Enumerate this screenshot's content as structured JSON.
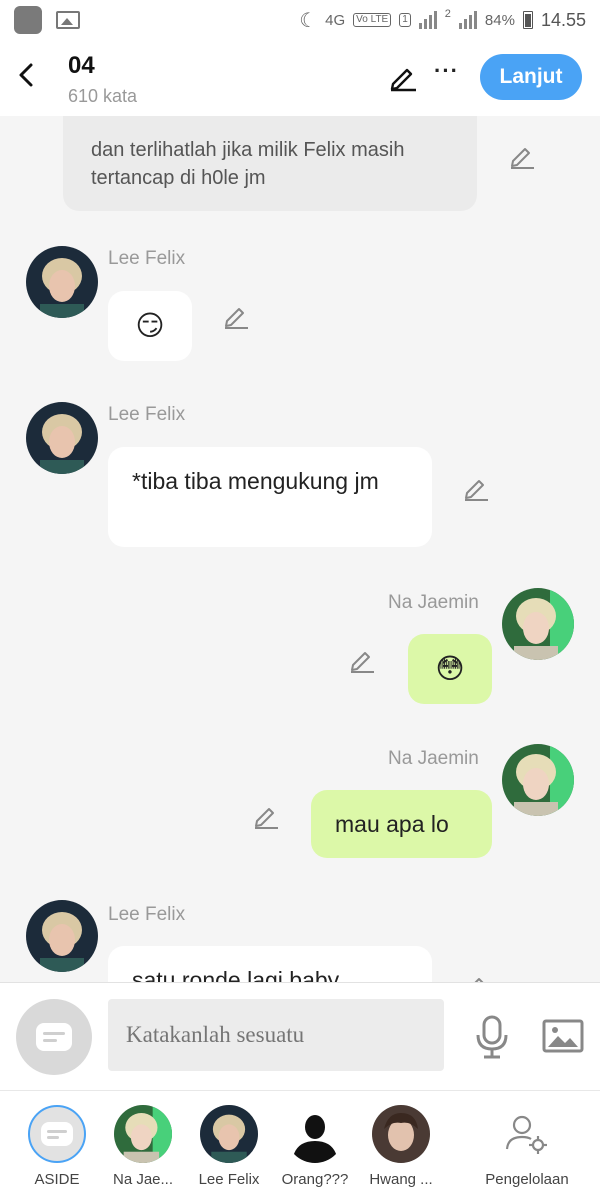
{
  "status_bar": {
    "network": "4G",
    "volte": "Vo LTE",
    "sim1": "1",
    "sim2": "2",
    "battery": "84%",
    "time": "14.55"
  },
  "header": {
    "title": "04",
    "word_count": "610 kata",
    "next_label": "Lanjut"
  },
  "messages": [
    {
      "type": "narration",
      "text": "dan terlihatlah jika milik Felix masih tertancap di h0le jm"
    },
    {
      "type": "left",
      "sender": "Lee Felix",
      "text": "😏"
    },
    {
      "type": "left",
      "sender": "Lee Felix",
      "text": "*tiba tiba mengukung jm"
    },
    {
      "type": "right",
      "sender": "Na Jaemin",
      "text": "😳"
    },
    {
      "type": "right",
      "sender": "Na Jaemin",
      "text": "mau apa lo"
    },
    {
      "type": "left",
      "sender": "Lee Felix",
      "text": "satu ronde lagi baby"
    }
  ],
  "composer": {
    "placeholder": "Katakanlah sesuatu"
  },
  "characters": [
    {
      "label": "ASIDE"
    },
    {
      "label": "Na Jae..."
    },
    {
      "label": "Lee Felix"
    },
    {
      "label": "Orang???"
    },
    {
      "label": "Hwang ..."
    },
    {
      "label": "Pengelolaan"
    }
  ],
  "colors": {
    "accent": "#4aa3f5",
    "bubble_right": "#dcf8a8",
    "bubble_left": "#ffffff",
    "narration_bg": "#ebebeb"
  }
}
